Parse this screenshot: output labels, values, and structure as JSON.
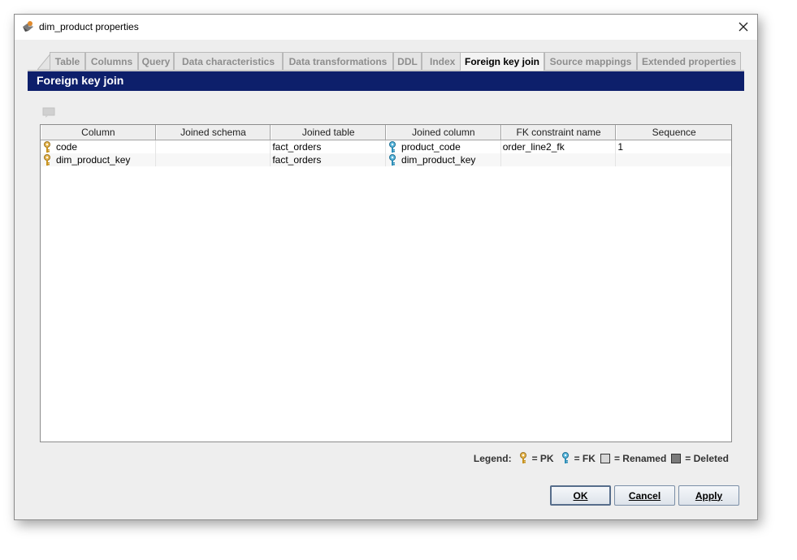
{
  "window": {
    "title": "dim_product properties"
  },
  "tabs": [
    "Table",
    "Columns",
    "Query",
    "Data characteristics",
    "Data transformations",
    "DDL",
    "Index",
    "Foreign key join",
    "Source mappings",
    "Extended properties"
  ],
  "active_tab": "Foreign key join",
  "panel": {
    "title": "Foreign key join"
  },
  "table": {
    "headers": [
      "Column",
      "Joined schema",
      "Joined table",
      "Joined column",
      "FK constraint name",
      "Sequence"
    ],
    "rows": [
      {
        "column": "code",
        "joined_schema": "",
        "joined_table": "fact_orders",
        "joined_column": "product_code",
        "fk_constraint_name": "order_line2_fk",
        "sequence": "1"
      },
      {
        "column": "dim_product_key",
        "joined_schema": "",
        "joined_table": "fact_orders",
        "joined_column": "dim_product_key",
        "fk_constraint_name": "",
        "sequence": ""
      }
    ]
  },
  "legend": {
    "label": "Legend:",
    "pk": "= PK",
    "fk": "= FK",
    "renamed": "= Renamed",
    "deleted": "= Deleted"
  },
  "buttons": {
    "ok": "OK",
    "cancel": "Cancel",
    "apply": "Apply"
  },
  "colors": {
    "header_bg": "#0d1f6b",
    "pk_key": "#d9a63a",
    "fk_key": "#3a9ec9",
    "renamed": "#d6d6d6",
    "deleted": "#7a7a7a"
  },
  "icons": {
    "pk": "pk-key-icon",
    "fk": "fk-key-icon"
  }
}
